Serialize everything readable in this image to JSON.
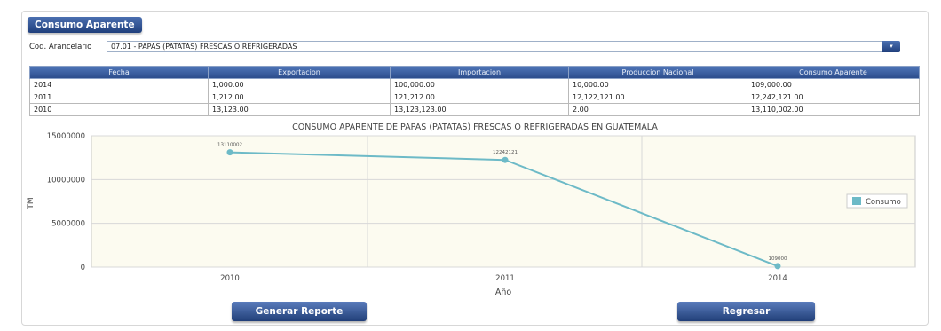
{
  "section": {
    "title": "Consumo Aparente"
  },
  "filter": {
    "label": "Cod. Arancelario",
    "selected": "07.01 - PAPAS (PATATAS) FRESCAS O REFRIGERADAS",
    "dropdown_icon": "chevron-down-icon"
  },
  "table": {
    "headers": [
      "Fecha",
      "Exportacion",
      "Importacion",
      "Produccion Nacional",
      "Consumo Aparente"
    ],
    "rows": [
      [
        "2014",
        "1,000.00",
        "100,000.00",
        "10,000.00",
        "109,000.00"
      ],
      [
        "2011",
        "1,212.00",
        "121,212.00",
        "12,122,121.00",
        "12,242,121.00"
      ],
      [
        "2010",
        "13,123.00",
        "13,123,123.00",
        "2.00",
        "13,110,002.00"
      ]
    ]
  },
  "chart_data": {
    "type": "line",
    "title": "CONSUMO APARENTE DE PAPAS (PATATAS) FRESCAS O REFRIGERADAS EN GUATEMALA",
    "xlabel": "Año",
    "ylabel": "TM",
    "categories": [
      "2010",
      "2011",
      "2014"
    ],
    "series": [
      {
        "name": "Consumo",
        "values": [
          13110002,
          12242121,
          109000
        ],
        "color": "#6dbac7"
      }
    ],
    "point_labels": [
      "13110002",
      "12242121",
      "109000"
    ],
    "yticks": [
      "0",
      "5000000",
      "10000000",
      "15000000"
    ],
    "ylim": [
      0,
      15000000
    ],
    "grid": true,
    "legend": "right",
    "plot_background": "#fcfbf0"
  },
  "buttons": {
    "generate": "Generar Reporte",
    "back": "Regresar"
  },
  "colors": {
    "header_blue": "#2b4c8b",
    "line": "#6dbac7"
  }
}
